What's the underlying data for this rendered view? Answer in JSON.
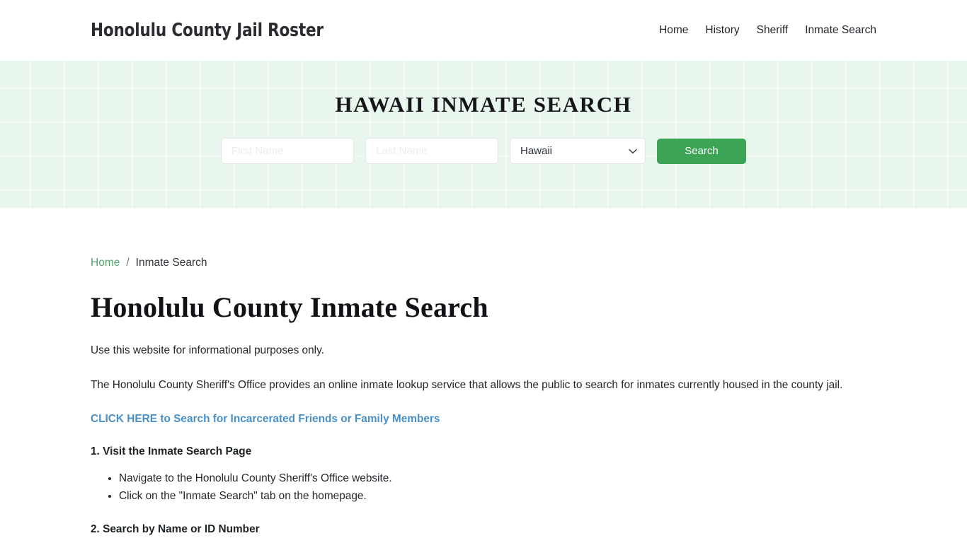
{
  "header": {
    "brand": "Honolulu County Jail Roster",
    "nav": [
      {
        "label": "Home"
      },
      {
        "label": "History"
      },
      {
        "label": "Sheriff"
      },
      {
        "label": "Inmate Search"
      }
    ]
  },
  "hero": {
    "title": "HAWAII INMATE SEARCH",
    "form": {
      "first_name_value": "",
      "first_name_placeholder": "First Name",
      "last_name_value": "",
      "last_name_placeholder": "Last Name",
      "state_selected": "Hawaii",
      "state_options": [
        "Hawaii"
      ],
      "chevron_icon": "chevron-down-icon",
      "search_label": "Search"
    },
    "background_color": "#e9f6ee",
    "button_color": "#3ca455"
  },
  "breadcrumb": {
    "home": "Home",
    "separator": "/",
    "current": "Inmate Search",
    "link_color": "#50a56a"
  },
  "main": {
    "page_title": "Honolulu County Inmate Search",
    "intro": "Use this website for informational purposes only.",
    "paragraph": "The Honolulu County Sheriff's Office provides an online inmate lookup service that allows the public to search for inmates currently housed in the county jail.",
    "cta_link": "CLICK HERE to Search for Incarcerated Friends or Family Members",
    "cta_color": "#4a90c7",
    "steps": [
      {
        "heading": "1. Visit the Inmate Search Page",
        "items": [
          "Navigate to the Honolulu County Sheriff's Office website.",
          "Click on the \"Inmate Search\" tab on the homepage."
        ]
      },
      {
        "heading": "2. Search by Name or ID Number",
        "items": []
      }
    ]
  }
}
